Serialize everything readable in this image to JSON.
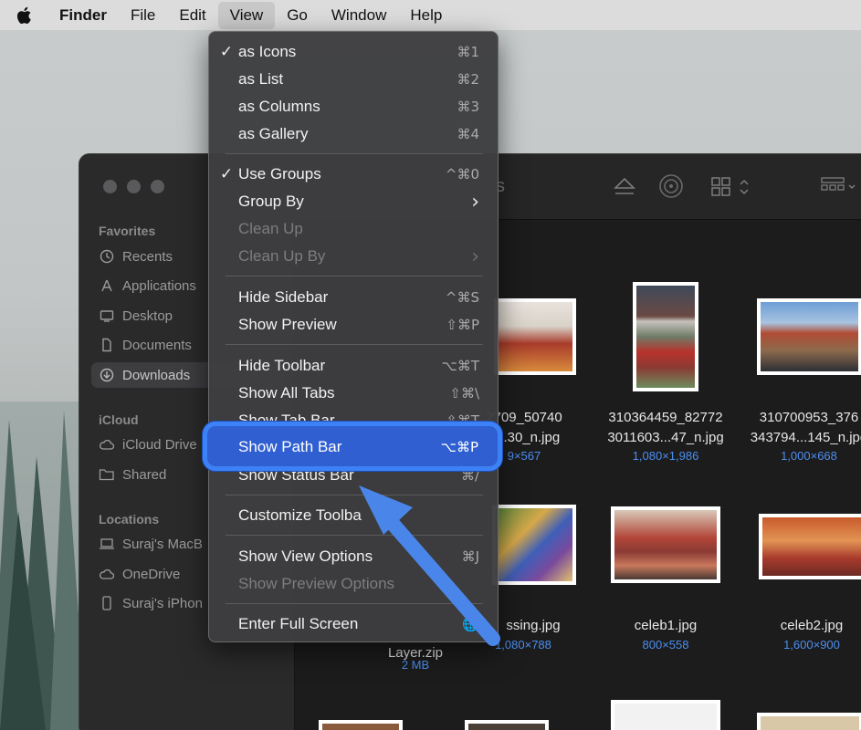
{
  "menubar": {
    "apple": "apple-logo",
    "items": [
      "Finder",
      "File",
      "Edit",
      "View",
      "Go",
      "Window",
      "Help"
    ]
  },
  "sidebar": {
    "favorites_title": "Favorites",
    "favorites": [
      "Recents",
      "Applications",
      "Desktop",
      "Documents",
      "Downloads"
    ],
    "icloud_title": "iCloud",
    "icloud": [
      "iCloud Drive",
      "Shared"
    ],
    "locations_title": "Locations",
    "locations": [
      "Suraj's MacB",
      "OneDrive",
      "Suraj's iPhon"
    ]
  },
  "toolbar": {
    "title_fragment": "s"
  },
  "files": [
    {
      "name1": "2709_50740",
      "name2": "1...30_n.jpg",
      "dims": "9×567"
    },
    {
      "name1": "310364459_82772",
      "name2": "3011603...47_n.jpg",
      "dims": "1,080×1,986"
    },
    {
      "name1": "310700953_376",
      "name2": "343794...145_n.jpg",
      "dims": "1,000×668"
    },
    {
      "name1": "Layer.zip",
      "dims": "2 MB"
    },
    {
      "name1": "ssing.jpg",
      "dims": "1,080×788"
    },
    {
      "name1": "celeb1.jpg",
      "dims": "800×558"
    },
    {
      "name1": "celeb2.jpg",
      "dims": "1,600×900"
    }
  ],
  "view_menu": {
    "as_icons": "as Icons",
    "as_icons_sc": "⌘1",
    "as_list": "as List",
    "as_list_sc": "⌘2",
    "as_columns": "as Columns",
    "as_columns_sc": "⌘3",
    "as_gallery": "as Gallery",
    "as_gallery_sc": "⌘4",
    "use_groups": "Use Groups",
    "use_groups_sc": "^⌘0",
    "group_by": "Group By",
    "clean_up": "Clean Up",
    "clean_up_by": "Clean Up By",
    "hide_sidebar": "Hide Sidebar",
    "hide_sidebar_sc": "^⌘S",
    "show_preview": "Show Preview",
    "show_preview_sc": "⇧⌘P",
    "hide_toolbar": "Hide Toolbar",
    "hide_toolbar_sc": "⌥⌘T",
    "show_all_tabs": "Show All Tabs",
    "show_all_tabs_sc": "⇧⌘\\",
    "show_tab_bar": "Show Tab Bar",
    "show_tab_bar_sc": "⇧⌘T",
    "show_path_bar": "Show Path Bar",
    "show_path_bar_sc": "⌥⌘P",
    "show_status_bar": "Show Status Bar",
    "show_status_bar_sc": "⌘/",
    "customize_toolbar": "Customize Toolba",
    "show_view_options": "Show View Options",
    "show_view_options_sc": "⌘J",
    "show_preview_options": "Show Preview Options",
    "enter_full_screen": "Enter Full Screen",
    "check": "✓",
    "submenu": "›",
    "globe": "🌐"
  },
  "colors": {
    "highlight": "#3c82f6",
    "arrow": "#4a86ea"
  }
}
